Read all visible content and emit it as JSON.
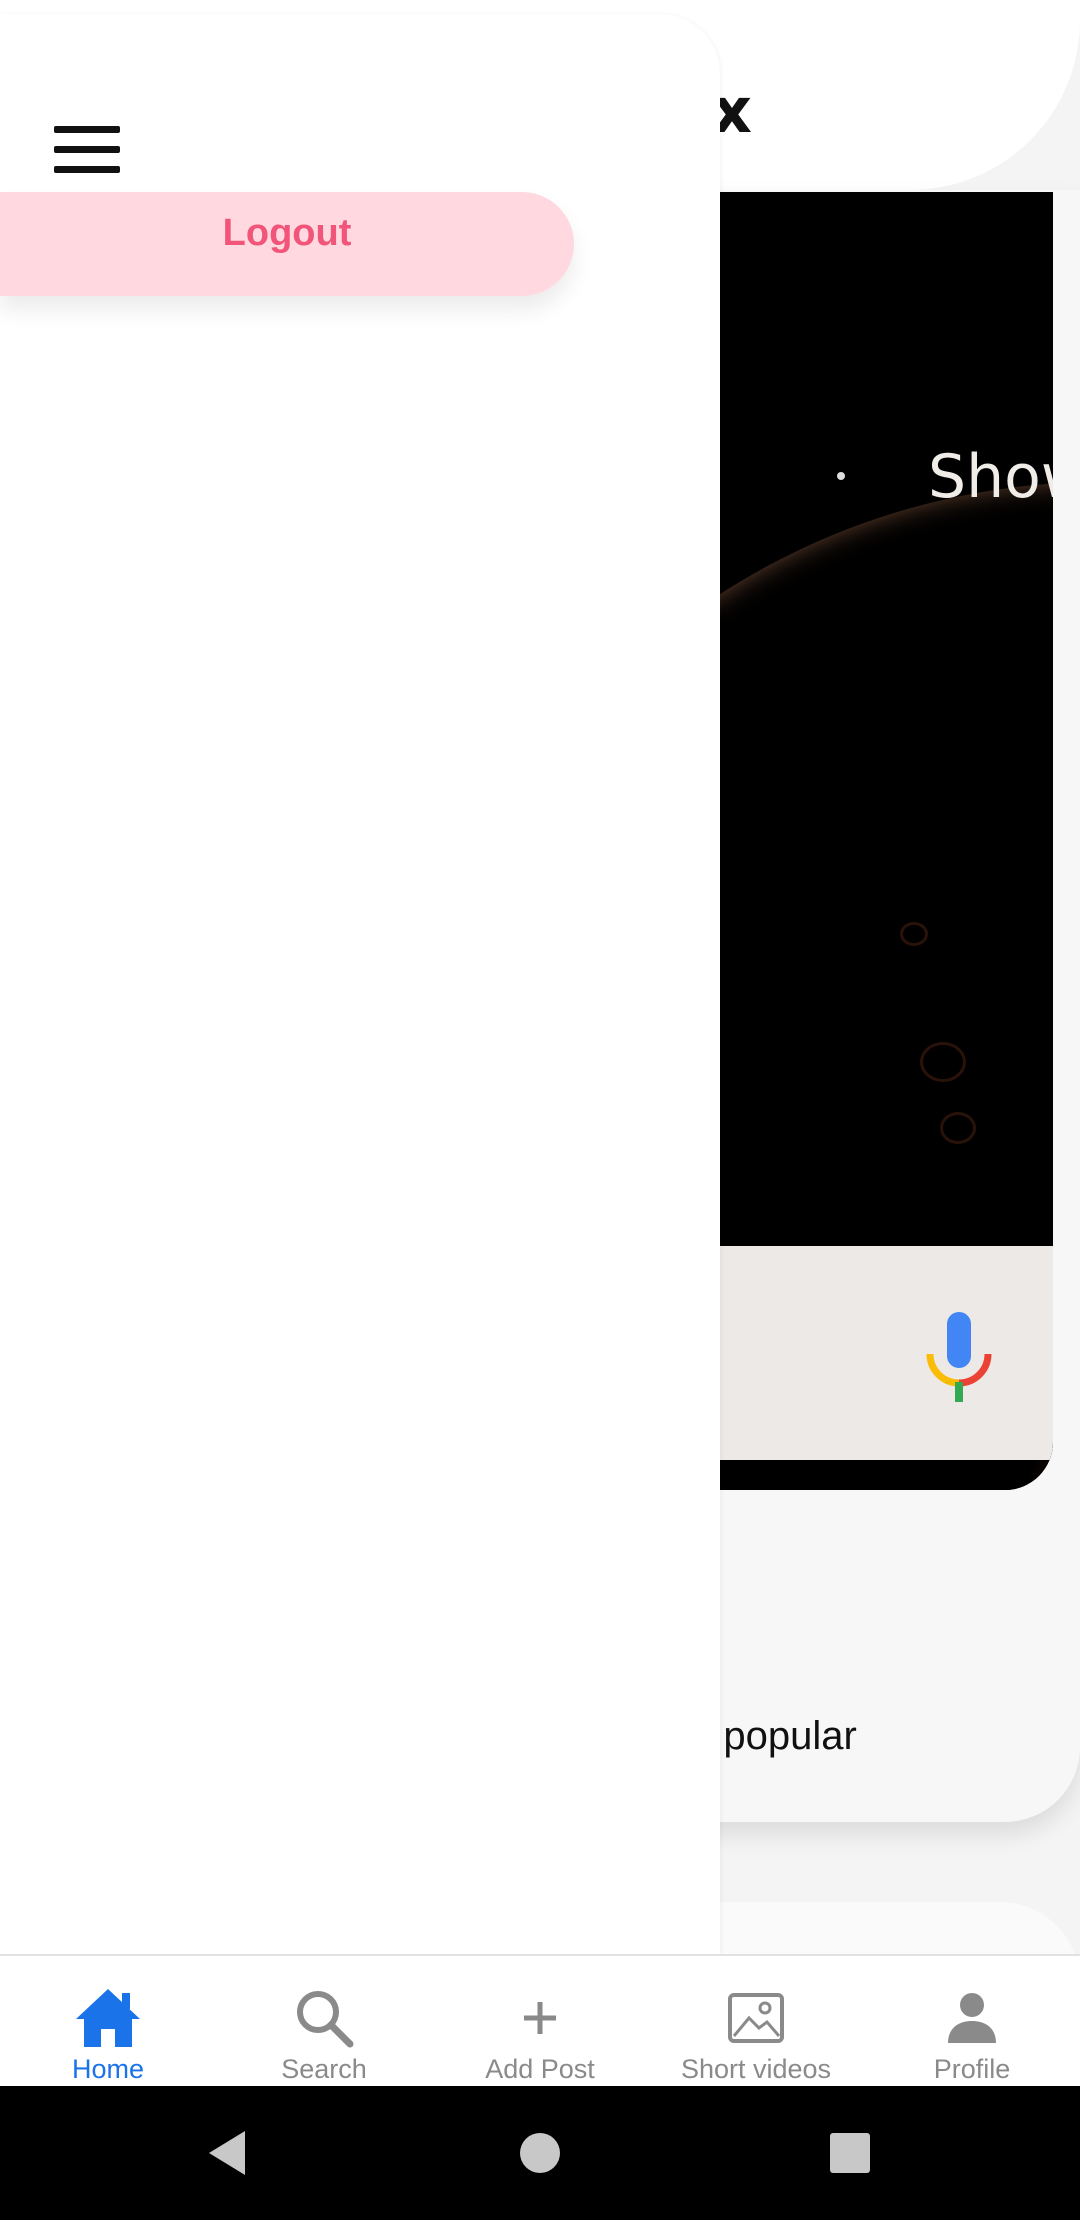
{
  "background": {
    "header_partial_title": "x",
    "image_overlay_partial_text": "Show",
    "section_partial_text": "e popular"
  },
  "drawer": {
    "menu_icon": "hamburger-menu-icon",
    "logout_label": "Logout"
  },
  "bottom_nav": {
    "items": [
      {
        "label": "Home",
        "icon": "home-icon",
        "active": true
      },
      {
        "label": "Search",
        "icon": "search-icon",
        "active": false
      },
      {
        "label": "Add Post",
        "icon": "plus-icon",
        "active": false
      },
      {
        "label": "Short videos",
        "icon": "image-icon",
        "active": false
      },
      {
        "label": "Profile",
        "icon": "person-icon",
        "active": false
      }
    ]
  },
  "system_nav": {
    "back": "back-triangle-icon",
    "home": "home-circle-icon",
    "recents": "recents-square-icon"
  },
  "colors": {
    "accent": "#1a73e8",
    "logout_bg": "#ffd9df",
    "logout_text": "#f2557a",
    "inactive": "#8a8a8a"
  }
}
